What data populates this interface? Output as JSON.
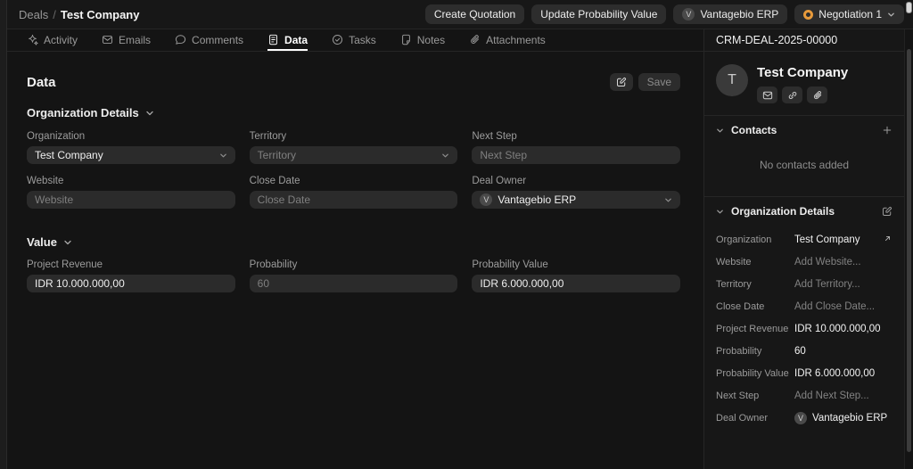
{
  "topbar": {
    "breadcrumb": {
      "root": "Deals",
      "separator": "/",
      "current": "Test Company"
    },
    "create_quotation_label": "Create Quotation",
    "update_probability_label": "Update Probability Value",
    "owner": {
      "initial": "V",
      "name": "Vantagebio ERP"
    },
    "stage": {
      "label": "Negotiation 1"
    }
  },
  "tabs": [
    {
      "label": "Activity",
      "icon": "activity-icon",
      "active": false
    },
    {
      "label": "Emails",
      "icon": "email-icon",
      "active": false
    },
    {
      "label": "Comments",
      "icon": "comment-icon",
      "active": false
    },
    {
      "label": "Data",
      "icon": "data-icon",
      "active": true
    },
    {
      "label": "Tasks",
      "icon": "task-icon",
      "active": false
    },
    {
      "label": "Notes",
      "icon": "note-icon",
      "active": false
    },
    {
      "label": "Attachments",
      "icon": "paperclip-icon",
      "active": false
    }
  ],
  "main": {
    "title": "Data",
    "save_label": "Save",
    "org_details": {
      "title": "Organization Details",
      "fields": [
        {
          "label": "Organization",
          "value": "Test Company",
          "type": "select"
        },
        {
          "label": "Territory",
          "placeholder": "Territory",
          "type": "select"
        },
        {
          "label": "Next Step",
          "placeholder": "Next Step",
          "type": "input"
        },
        {
          "label": "Website",
          "placeholder": "Website",
          "type": "input"
        },
        {
          "label": "Close Date",
          "placeholder": "Close Date",
          "type": "input"
        },
        {
          "label": "Deal Owner",
          "value": "Vantagebio ERP",
          "avatar": "V",
          "type": "select"
        }
      ]
    },
    "value_section": {
      "title": "Value",
      "fields": [
        {
          "label": "Project Revenue",
          "value": "IDR 10.000.000,00"
        },
        {
          "label": "Probability",
          "value": "60"
        },
        {
          "label": "Probability Value",
          "value": "IDR 6.000.000,00"
        }
      ]
    }
  },
  "sidebar": {
    "doc_id": "CRM-DEAL-2025-00000",
    "profile": {
      "initial": "T",
      "name": "Test Company"
    },
    "contacts": {
      "title": "Contacts",
      "empty_text": "No contacts added"
    },
    "org_details": {
      "title": "Organization Details",
      "rows": [
        {
          "label": "Organization",
          "value": "Test Company"
        },
        {
          "label": "Website",
          "value": "Add Website..."
        },
        {
          "label": "Territory",
          "value": "Add Territory..."
        },
        {
          "label": "Close Date",
          "value": "Add Close Date..."
        },
        {
          "label": "Project Revenue",
          "value": "IDR 10.000.000,00"
        },
        {
          "label": "Probability",
          "value": "60"
        },
        {
          "label": "Probability Value",
          "value": "IDR 6.000.000,00"
        },
        {
          "label": "Next Step",
          "value": "Add Next Step..."
        },
        {
          "label": "Deal Owner",
          "value": "Vantagebio ERP",
          "avatar": "V"
        }
      ]
    }
  },
  "colors": {
    "stage_orange": "#e79a3b",
    "background": "#141414",
    "panel": "#171717",
    "field": "#2b2b2b"
  }
}
